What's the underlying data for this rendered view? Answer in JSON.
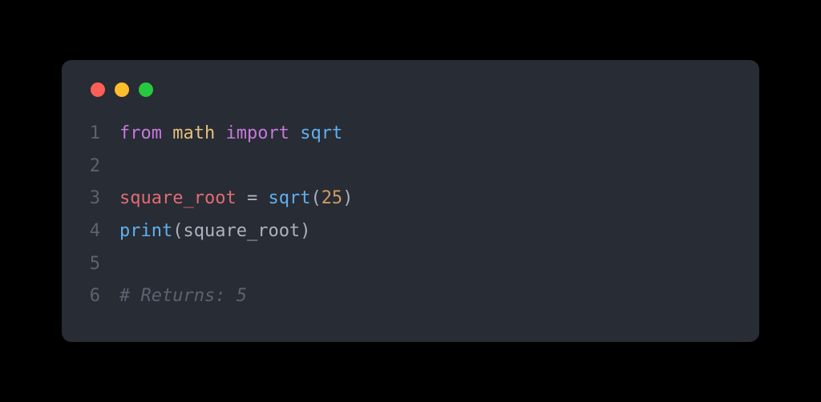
{
  "window": {
    "traffic": {
      "red": "#ff5f56",
      "yellow": "#ffbd2e",
      "green": "#27c93f"
    }
  },
  "code": {
    "lines": [
      {
        "n": "1",
        "tokens": [
          {
            "t": "from",
            "c": "kw"
          },
          {
            "t": " ",
            "c": "ident"
          },
          {
            "t": "math",
            "c": "mod"
          },
          {
            "t": " ",
            "c": "ident"
          },
          {
            "t": "import",
            "c": "kw"
          },
          {
            "t": " ",
            "c": "ident"
          },
          {
            "t": "sqrt",
            "c": "fn"
          }
        ]
      },
      {
        "n": "2",
        "tokens": []
      },
      {
        "n": "3",
        "tokens": [
          {
            "t": "square_root",
            "c": "var"
          },
          {
            "t": " ",
            "c": "ident"
          },
          {
            "t": "=",
            "c": "punc"
          },
          {
            "t": " ",
            "c": "ident"
          },
          {
            "t": "sqrt",
            "c": "call"
          },
          {
            "t": "(",
            "c": "punc"
          },
          {
            "t": "25",
            "c": "num"
          },
          {
            "t": ")",
            "c": "punc"
          }
        ]
      },
      {
        "n": "4",
        "tokens": [
          {
            "t": "print",
            "c": "builtin"
          },
          {
            "t": "(",
            "c": "punc"
          },
          {
            "t": "square_root",
            "c": "ident"
          },
          {
            "t": ")",
            "c": "punc"
          }
        ]
      },
      {
        "n": "5",
        "tokens": []
      },
      {
        "n": "6",
        "tokens": [
          {
            "t": "# Returns: 5",
            "c": "comment"
          }
        ]
      }
    ]
  }
}
